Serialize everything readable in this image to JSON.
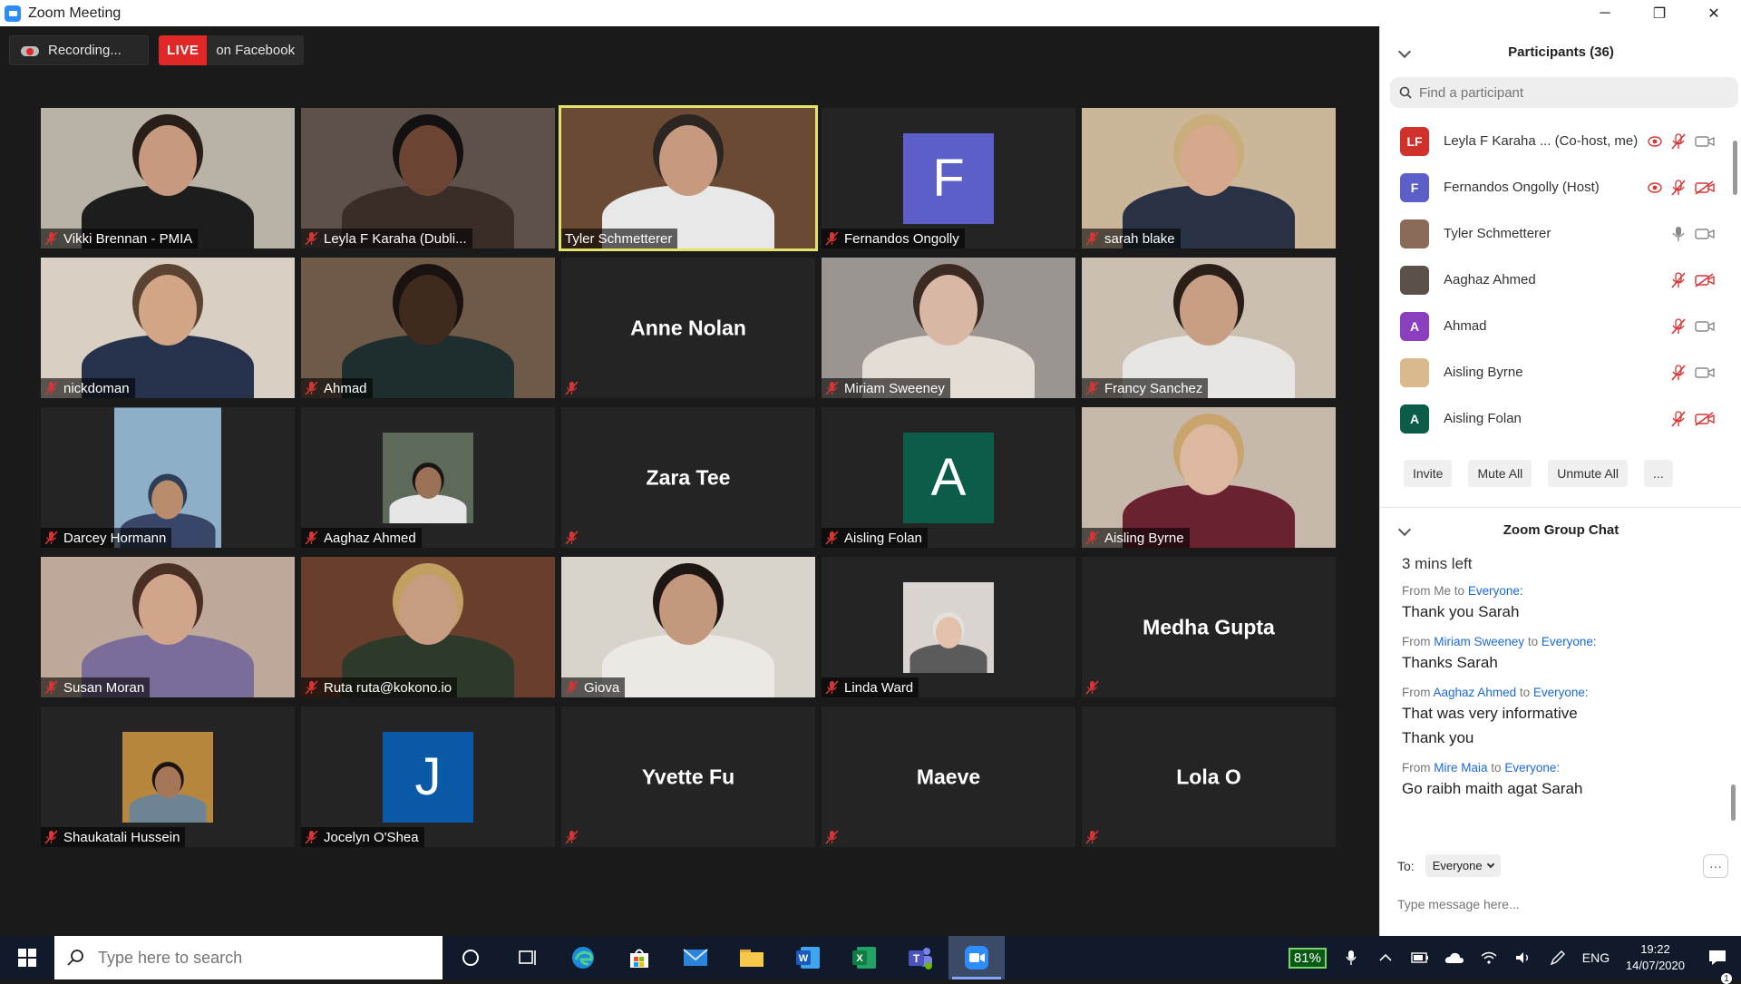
{
  "window": {
    "title": "Zoom Meeting",
    "minimize_glyph": "─",
    "maximize_glyph": "❐",
    "close_glyph": "✕"
  },
  "meeting": {
    "recording_label": "Recording...",
    "live_label": "LIVE",
    "live_platform": "on Facebook",
    "tiles": [
      {
        "name": "Vikki Brennan - PMIA",
        "kind": "video",
        "bg": "#b9b2a6",
        "skin": "#c79a7f",
        "hair": "#2a1e18",
        "shirt": "#1d1d1d",
        "muted": true
      },
      {
        "name": "Leyla F Karaha (Dubli...",
        "kind": "video",
        "bg": "#5d5149",
        "skin": "#6b4434",
        "hair": "#121010",
        "shirt": "#3a2c26",
        "muted": true
      },
      {
        "name": "Tyler Schmetterer",
        "kind": "video",
        "bg": "#6b4a33",
        "skin": "#c79a80",
        "hair": "#2c2622",
        "shirt": "#e8e8e8",
        "muted": false,
        "active": true
      },
      {
        "name": "Fernandos Ongolly",
        "kind": "initial",
        "initial": "F",
        "color": "#5b5fc7",
        "muted": true
      },
      {
        "name": "sarah blake",
        "kind": "video",
        "bg": "#cbb69a",
        "skin": "#d6a98e",
        "hair": "#c9ad7a",
        "shirt": "#283244",
        "muted": true
      },
      {
        "name": "nickdoman",
        "kind": "video",
        "bg": "#d9cfc2",
        "skin": "#d2a586",
        "hair": "#5a4330",
        "shirt": "#26324c",
        "muted": true
      },
      {
        "name": "Ahmad",
        "kind": "video",
        "bg": "#6f5a48",
        "skin": "#3f2a1e",
        "hair": "#1a1210",
        "shirt": "#1e2e2e",
        "muted": true
      },
      {
        "name": "Anne Nolan",
        "kind": "bigname",
        "muted": true
      },
      {
        "name": "Miriam Sweeney",
        "kind": "video",
        "bg": "#9a9590",
        "skin": "#d8b7a5",
        "hair": "#3a2a22",
        "shirt": "#e3ddd6",
        "muted": true
      },
      {
        "name": "Francy Sanchez",
        "kind": "video",
        "bg": "#cabfb1",
        "skin": "#c89f85",
        "hair": "#2a1e18",
        "shirt": "#e8e6e3",
        "muted": true
      },
      {
        "name": "Darcey Hormann",
        "kind": "thumb-tall",
        "bg": "#8db0c8",
        "skin": "#b98c6c",
        "hair": "#2f3e57",
        "shirt": "#39466a",
        "muted": true
      },
      {
        "name": "Aaghaz Ahmed",
        "kind": "thumb",
        "bg": "#5d6a5a",
        "skin": "#9b7257",
        "hair": "#1a1412",
        "shirt": "#e6e6e6",
        "muted": true
      },
      {
        "name": "Zara Tee",
        "kind": "bigname",
        "muted": true
      },
      {
        "name": "Aisling Folan",
        "kind": "initial",
        "initial": "A",
        "color": "#0c5c4a",
        "muted": true
      },
      {
        "name": "Aisling Byrne",
        "kind": "video",
        "bg": "#c6b9ab",
        "skin": "#dcb8a0",
        "hair": "#c9a46d",
        "shirt": "#6a2230",
        "muted": true
      },
      {
        "name": "Susan Moran",
        "kind": "video",
        "bg": "#bfa99a",
        "skin": "#d0a58c",
        "hair": "#4a3024",
        "shirt": "#7a6d9a",
        "muted": true
      },
      {
        "name": "Ruta ruta@kokono.io",
        "kind": "video",
        "bg": "#6a3e2c",
        "skin": "#c79c81",
        "hair": "#c2a062",
        "shirt": "#2d3a2a",
        "muted": true
      },
      {
        "name": "Giova",
        "kind": "video",
        "bg": "#d8d4cc",
        "skin": "#c3987c",
        "hair": "#1e1612",
        "shirt": "#ece9e4",
        "muted": true
      },
      {
        "name": "Linda Ward",
        "kind": "thumb",
        "bg": "#d9d4cf",
        "skin": "#e4c1ab",
        "hair": "#e2e2de",
        "shirt": "#5b5b5b",
        "muted": true
      },
      {
        "name": "Medha Gupta",
        "kind": "bigname",
        "muted": true
      },
      {
        "name": "Shaukatali Hussein",
        "kind": "thumb",
        "bg": "#b8873e",
        "skin": "#a57758",
        "hair": "#1c1410",
        "shirt": "#6d8494",
        "muted": true
      },
      {
        "name": "Jocelyn O'Shea",
        "kind": "initial",
        "initial": "J",
        "color": "#0b5aa8",
        "muted": true
      },
      {
        "name": "Yvette Fu",
        "kind": "bigname",
        "muted": true
      },
      {
        "name": "Maeve",
        "kind": "bigname",
        "muted": true
      },
      {
        "name": "Lola O",
        "kind": "bigname",
        "muted": true
      }
    ]
  },
  "participants": {
    "header": "Participants (36)",
    "search_placeholder": "Find a participant",
    "list": [
      {
        "name": "Leyla F Karaha ... (Co-host, me)",
        "avatar_text": "LF",
        "avatar_color": "#d0312d",
        "recording": true,
        "mic": "muted",
        "video": "on"
      },
      {
        "name": "Fernandos Ongolly (Host)",
        "avatar_text": "F",
        "avatar_color": "#5b5fc7",
        "recording": true,
        "mic": "muted",
        "video": "off"
      },
      {
        "name": "Tyler Schmetterer",
        "avatar_text": "",
        "avatar_color": "#8a6a58",
        "recording": false,
        "mic": "on",
        "video": "on"
      },
      {
        "name": "Aaghaz Ahmed",
        "avatar_text": "",
        "avatar_color": "#5a5248",
        "recording": false,
        "mic": "muted",
        "video": "off"
      },
      {
        "name": "Ahmad",
        "avatar_text": "A",
        "avatar_color": "#8a3fbf",
        "recording": false,
        "mic": "muted",
        "video": "on"
      },
      {
        "name": "Aisling Byrne",
        "avatar_text": "",
        "avatar_color": "#d9b98e",
        "recording": false,
        "mic": "muted",
        "video": "on"
      },
      {
        "name": "Aisling Folan",
        "avatar_text": "A",
        "avatar_color": "#0c5c4a",
        "recording": false,
        "mic": "muted",
        "video": "off"
      }
    ],
    "buttons": {
      "invite": "Invite",
      "mute_all": "Mute All",
      "unmute_all": "Unmute All",
      "more": "..."
    }
  },
  "chat": {
    "header": "Zoom Group Chat",
    "timer": "3 mins left",
    "messages": [
      {
        "prefix": "From",
        "sender": "Me",
        "to_word": "to",
        "recipient": "Everyone:",
        "lines": [
          "Thank you Sarah"
        ],
        "sender_link": false
      },
      {
        "prefix": "From",
        "sender": "Miriam Sweeney",
        "to_word": "to",
        "recipient": "Everyone:",
        "lines": [
          "Thanks Sarah"
        ],
        "sender_link": true
      },
      {
        "prefix": "From",
        "sender": "Aaghaz Ahmed",
        "to_word": "to",
        "recipient": "Everyone:",
        "lines": [
          "That was very informative",
          "Thank you"
        ],
        "sender_link": true
      },
      {
        "prefix": "From",
        "sender": "Mire Maia",
        "to_word": "to",
        "recipient": "Everyone:",
        "lines": [
          "Go raibh maith agat Sarah"
        ],
        "sender_link": true
      }
    ],
    "to_label": "To:",
    "to_value": "Everyone",
    "more": "···",
    "input_placeholder": "Type message here..."
  },
  "taskbar": {
    "search_placeholder": "Type here to search",
    "battery": "81%",
    "language": "ENG",
    "time": "19:22",
    "date": "14/07/2020",
    "notification_count": "1"
  }
}
